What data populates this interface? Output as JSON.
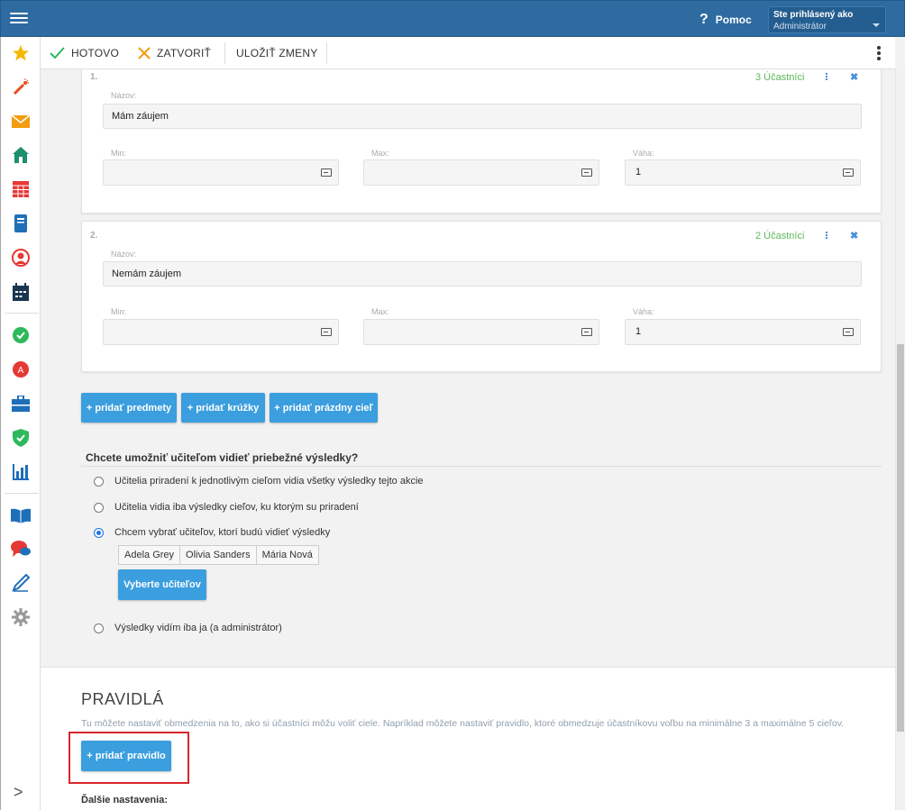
{
  "header": {
    "help_label": "Pomoc",
    "help_glyph": "?",
    "user_line1": "Ste prihlásený ako",
    "user_line2": "Administrátor"
  },
  "toolbar": {
    "done_label": "HOTOVO",
    "close_label": "ZATVORIŤ",
    "save_label": "ULOŽIŤ ZMENY"
  },
  "sidebar": {
    "icons": [
      "star-icon",
      "magic-wand-icon",
      "envelope-icon",
      "home-icon",
      "calendar-grid-icon",
      "notebook-icon",
      "user-icon",
      "schedule-icon",
      "check-badge-icon",
      "plus-badge-icon",
      "briefcase-icon",
      "shield-check-icon",
      "bar-chart-icon",
      "open-book-icon",
      "chat-icon",
      "pen-icon",
      "gear-icon"
    ],
    "expand_glyph": ">"
  },
  "goals": [
    {
      "number": "1.",
      "participants": "3 Účastníci",
      "name_label": "Názov:",
      "name_value": "Mám záujem",
      "min_label": "Min:",
      "min_value": "",
      "max_label": "Max:",
      "max_value": "",
      "weight_label": "Váha:",
      "weight_value": "1"
    },
    {
      "number": "2.",
      "participants": "2 Účastníci",
      "name_label": "Názov:",
      "name_value": "Nemám záujem",
      "min_label": "Min:",
      "min_value": "",
      "max_label": "Max:",
      "max_value": "",
      "weight_label": "Váha:",
      "weight_value": "1"
    }
  ],
  "add_buttons": {
    "subjects": "+ pridať predmety",
    "clubs": "+ pridať krúžky",
    "empty_goal": "+ pridať prázdny cieľ"
  },
  "visibility": {
    "question": "Chcete umožniť učiteľom vidieť priebežné výsledky?",
    "options": [
      "Učitelia priradení k jednotlivým cieľom vidia všetky výsledky tejto akcie",
      "Učitelia vidia iba výsledky cieľov, ku ktorým su priradení",
      "Chcem vybrať učiteľov, ktorí budú vidieť výsledky",
      "Výsledky vidím iba ja (a administrátor)"
    ],
    "selected_index": 2,
    "teachers": [
      "Adela Grey",
      "Olivia Sanders",
      "Mária Nová"
    ],
    "select_teachers_label": "Vyberte učiteľov"
  },
  "rules": {
    "title": "PRAVIDLÁ",
    "description": "Tu môžete nastaviť obmedzenia na to, ako si účastníci môžu voliť ciele. Napríklad môžete nastaviť pravidlo, ktoré obmedzuje účastníkovu voľbu na minimálne 3 a maximálne 5 cieľov.",
    "add_rule_label": "+ pridať pravidlo",
    "more_settings": "Ďalšie nastavenia:"
  },
  "colors": {
    "header_bg": "#2d6ba0",
    "accent_blue": "#3b9ede",
    "participants_green": "#5cb85c",
    "highlight_red": "#d9262c"
  }
}
